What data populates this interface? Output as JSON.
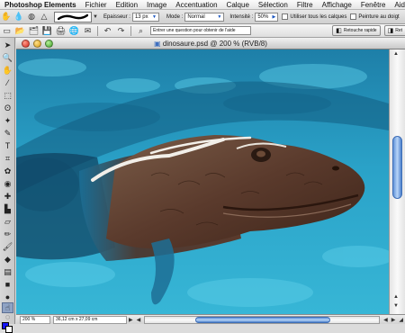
{
  "menubar": {
    "app_name": "Photoshop Elements",
    "items": [
      "Fichier",
      "Edition",
      "Image",
      "Accentuation",
      "Calque",
      "Sélection",
      "Filtre",
      "Affichage",
      "Fenêtre",
      "Aide"
    ]
  },
  "options_bar": {
    "size_label": "Epaisseur :",
    "size_value": "13 px",
    "mode_label": "Mode :",
    "mode_value": "Normal",
    "intensity_label": "Intensité :",
    "intensity_value": "50%",
    "all_layers_label": "Utiliser tous les calques",
    "finger_painting_label": "Peinture au doigt"
  },
  "shortcut_bar": {
    "help_placeholder": "Entrer une question pour obtenir de l'aide",
    "quick_fix_label": "Retouche rapide",
    "next_button_label": "Ret"
  },
  "document": {
    "title": "dinosaure.psd @ 200 % (RVB/8)",
    "zoom": "200 %",
    "dimensions": "36,12 cm x 27,09 cm"
  },
  "colors": {
    "foreground": "#1414ff",
    "background": "#ffffff",
    "water": "#2aa0c4"
  },
  "icons": {
    "apple": "apple-icon",
    "tools": [
      "move-icon",
      "zoom-icon",
      "hand-icon",
      "eyedropper-icon",
      "marquee-icon",
      "lasso-icon",
      "magic-wand-icon",
      "selection-brush-icon",
      "type-icon",
      "crop-icon",
      "cookie-cutter-icon",
      "red-eye-icon",
      "healing-brush-icon",
      "clone-stamp-icon",
      "eraser-icon",
      "pencil-icon",
      "brush-icon",
      "paint-bucket-icon",
      "gradient-icon",
      "shape-icon",
      "blur-icon",
      "sponge-icon",
      "smudge-icon"
    ]
  }
}
